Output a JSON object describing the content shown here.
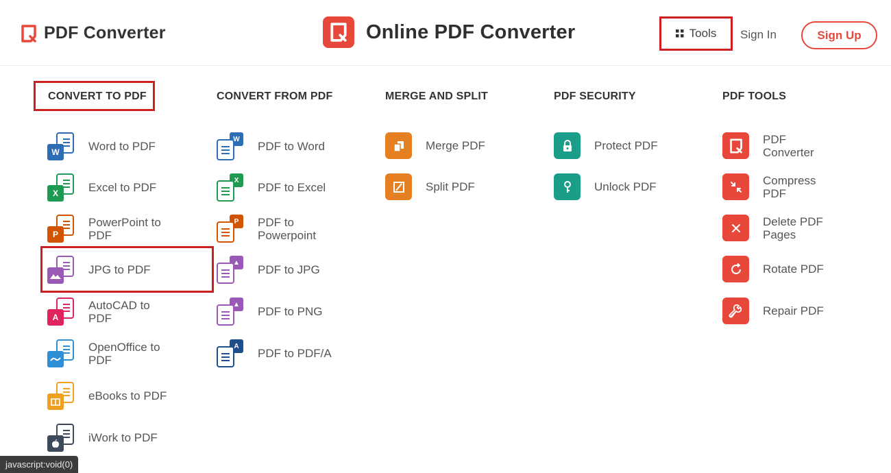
{
  "header": {
    "brand": "PDF Converter",
    "center_title": "Online PDF Converter",
    "tools_label": "Tools",
    "signin_label": "Sign In",
    "signup_label": "Sign Up"
  },
  "colors": {
    "accent": "#e8483c",
    "highlight": "#cc1f1f",
    "word": "#2d6db5",
    "excel": "#1e9a52",
    "powerpoint": "#d35400",
    "jpg": "#9b59b6",
    "autocad": "#e0245e",
    "openoffice": "#2e8fd6",
    "ebooks": "#f0a020",
    "iwork": "#3d4a5c",
    "merge": "#e67e22",
    "security": "#1a9e8a"
  },
  "columns": [
    {
      "title": "CONVERT TO PDF",
      "items": [
        {
          "label": "Word to PDF",
          "icon": "word-icon"
        },
        {
          "label": "Excel to PDF",
          "icon": "excel-icon"
        },
        {
          "label": "PowerPoint to PDF",
          "icon": "powerpoint-icon"
        },
        {
          "label": "JPG to PDF",
          "icon": "image-icon"
        },
        {
          "label": "AutoCAD to PDF",
          "icon": "autocad-icon"
        },
        {
          "label": "OpenOffice to PDF",
          "icon": "openoffice-icon"
        },
        {
          "label": "eBooks to PDF",
          "icon": "ebook-icon"
        },
        {
          "label": "iWork to PDF",
          "icon": "apple-icon"
        }
      ]
    },
    {
      "title": "CONVERT FROM PDF",
      "items": [
        {
          "label": "PDF to Word",
          "icon": "word-icon"
        },
        {
          "label": "PDF to Excel",
          "icon": "excel-icon"
        },
        {
          "label": "PDF to Powerpoint",
          "icon": "powerpoint-icon"
        },
        {
          "label": "PDF to JPG",
          "icon": "image-icon"
        },
        {
          "label": "PDF to PNG",
          "icon": "image-icon"
        },
        {
          "label": "PDF to PDF/A",
          "icon": "pdfa-icon"
        }
      ]
    },
    {
      "title": "MERGE AND SPLIT",
      "items": [
        {
          "label": "Merge PDF",
          "icon": "merge-icon"
        },
        {
          "label": "Split PDF",
          "icon": "split-icon"
        }
      ]
    },
    {
      "title": "PDF SECURITY",
      "items": [
        {
          "label": "Protect PDF",
          "icon": "lock-icon"
        },
        {
          "label": "Unlock PDF",
          "icon": "key-icon"
        }
      ]
    },
    {
      "title": "PDF TOOLS",
      "items": [
        {
          "label": "PDF Converter",
          "icon": "converter-icon"
        },
        {
          "label": "Compress PDF",
          "icon": "compress-icon"
        },
        {
          "label": "Delete PDF Pages",
          "icon": "delete-icon"
        },
        {
          "label": "Rotate PDF",
          "icon": "rotate-icon"
        },
        {
          "label": "Repair PDF",
          "icon": "wrench-icon"
        }
      ]
    }
  ],
  "status_bar": "javascript:void(0)"
}
